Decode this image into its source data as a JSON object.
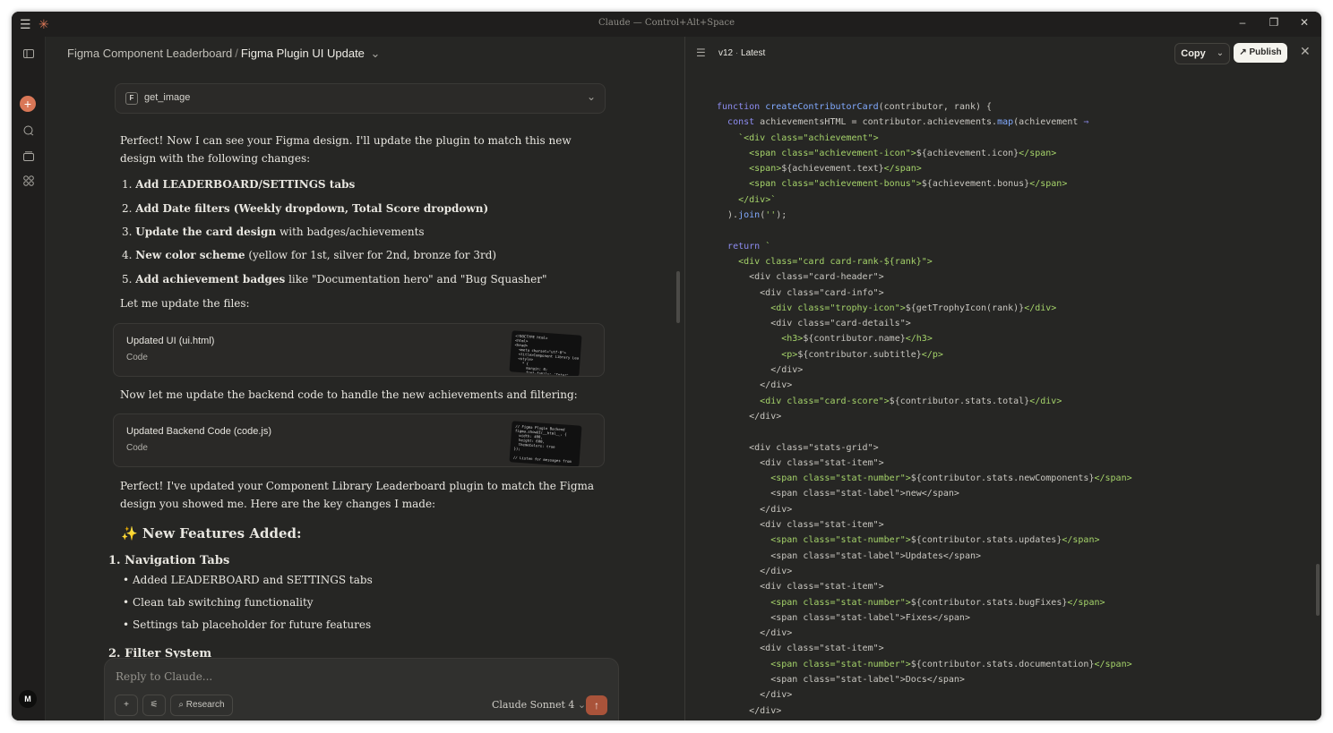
{
  "window": {
    "title": "Claude — Control+Alt+Space"
  },
  "titlebar": {
    "menu_icon": "☰",
    "logo_icon": "✳",
    "min": "–",
    "max": "❐",
    "close": "✕"
  },
  "header": {
    "project": "Figma Component Leaderboard",
    "separator": "/",
    "chat_title": "Figma Plugin UI Update",
    "chevron": "⌄"
  },
  "tool_call": {
    "badge": "F",
    "name": "get_image"
  },
  "messages": {
    "intro": "Perfect! Now I can see your Figma design. I'll update the plugin to match this new design with the following changes:",
    "changes": [
      {
        "num": "1.",
        "bold": "Add LEADERBOARD/SETTINGS tabs",
        "rest": ""
      },
      {
        "num": "2.",
        "bold": "Add Date filters (Weekly dropdown, Total Score dropdown)",
        "rest": ""
      },
      {
        "num": "3.",
        "bold": "Update the card design",
        "rest": " with badges/achievements"
      },
      {
        "num": "4.",
        "bold": "New color scheme",
        "rest": " (yellow for 1st, silver for 2nd, bronze for 3rd)"
      },
      {
        "num": "5.",
        "bold": "Add achievement badges",
        "rest": " like \"Documentation hero\" and \"Bug Squasher\""
      }
    ],
    "let_me": "Let me update the files:",
    "artifact1": {
      "title": "Updated UI (ui.html)",
      "type": "Code"
    },
    "backend_text": "Now let me update the backend code to handle the new achievements and filtering:",
    "artifact2": {
      "title": "Updated Backend Code (code.js)",
      "type": "Code"
    },
    "summary": "Perfect! I've updated your Component Library Leaderboard plugin to match the Figma design you showed me. Here are the key changes I made:",
    "features_heading": "✨ New Features Added:",
    "nav_heading": "1. Navigation Tabs",
    "nav_bullets": [
      "Added LEADERBOARD and SETTINGS tabs",
      "Clean tab switching functionality",
      "Settings tab placeholder for future features"
    ],
    "filter_heading": "2. Filter System"
  },
  "composer": {
    "placeholder": "Reply to Claude...",
    "add": "+",
    "tools": "⚟",
    "research": "Research",
    "model": "Claude Sonnet 4",
    "send": "↑"
  },
  "sidebar": {
    "avatar": "M"
  },
  "artifact": {
    "version": "v12",
    "latest": "Latest",
    "copy": "Copy",
    "publish": "Publish"
  }
}
